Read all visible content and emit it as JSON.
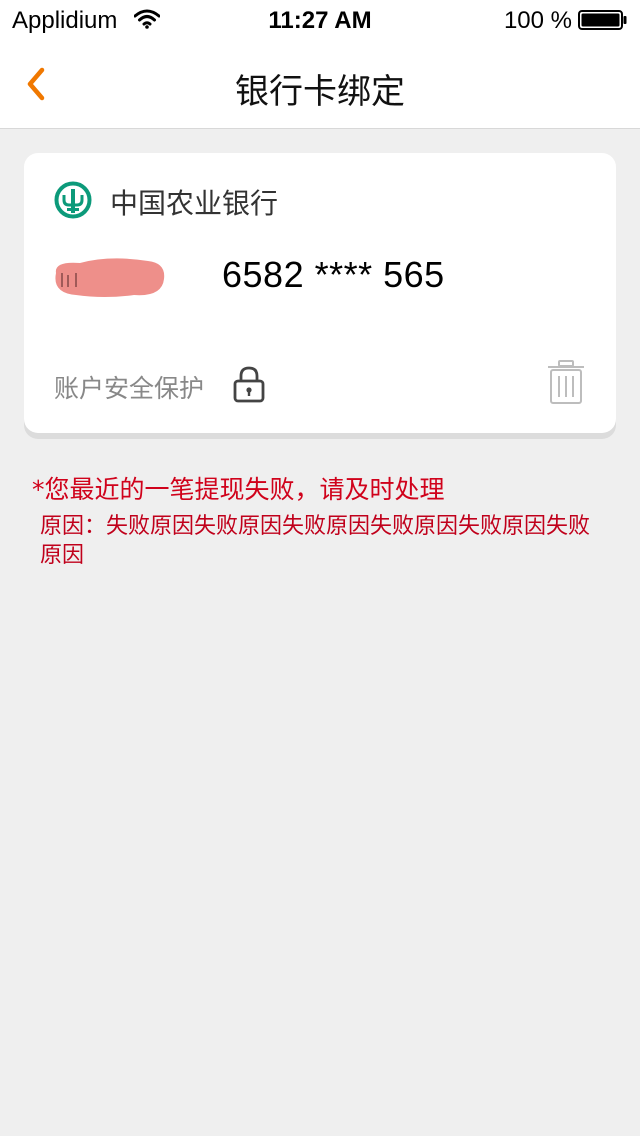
{
  "status_bar": {
    "carrier": "Applidium",
    "time": "11:27 AM",
    "battery_percent": "100 %",
    "icons": [
      "wifi-icon",
      "battery-icon"
    ]
  },
  "nav": {
    "title": "银行卡绑定",
    "back_icon": "chevron-left-icon",
    "accent_color": "#f07800"
  },
  "card": {
    "bank_name": "中国农业银行",
    "bank_logo_icon": "abc-bank-logo-icon",
    "bank_logo_color": "#0c9a7a",
    "card_number": "6582 **** 565",
    "security_label": "账户安全保护",
    "lock_icon": "lock-icon",
    "delete_icon": "trash-icon"
  },
  "warning": {
    "message": "*您最近的一笔提现失败，请及时处理",
    "reason": "原因：失败原因失败原因失败原因失败原因失败原因失败原因",
    "color": "#d0021b"
  }
}
